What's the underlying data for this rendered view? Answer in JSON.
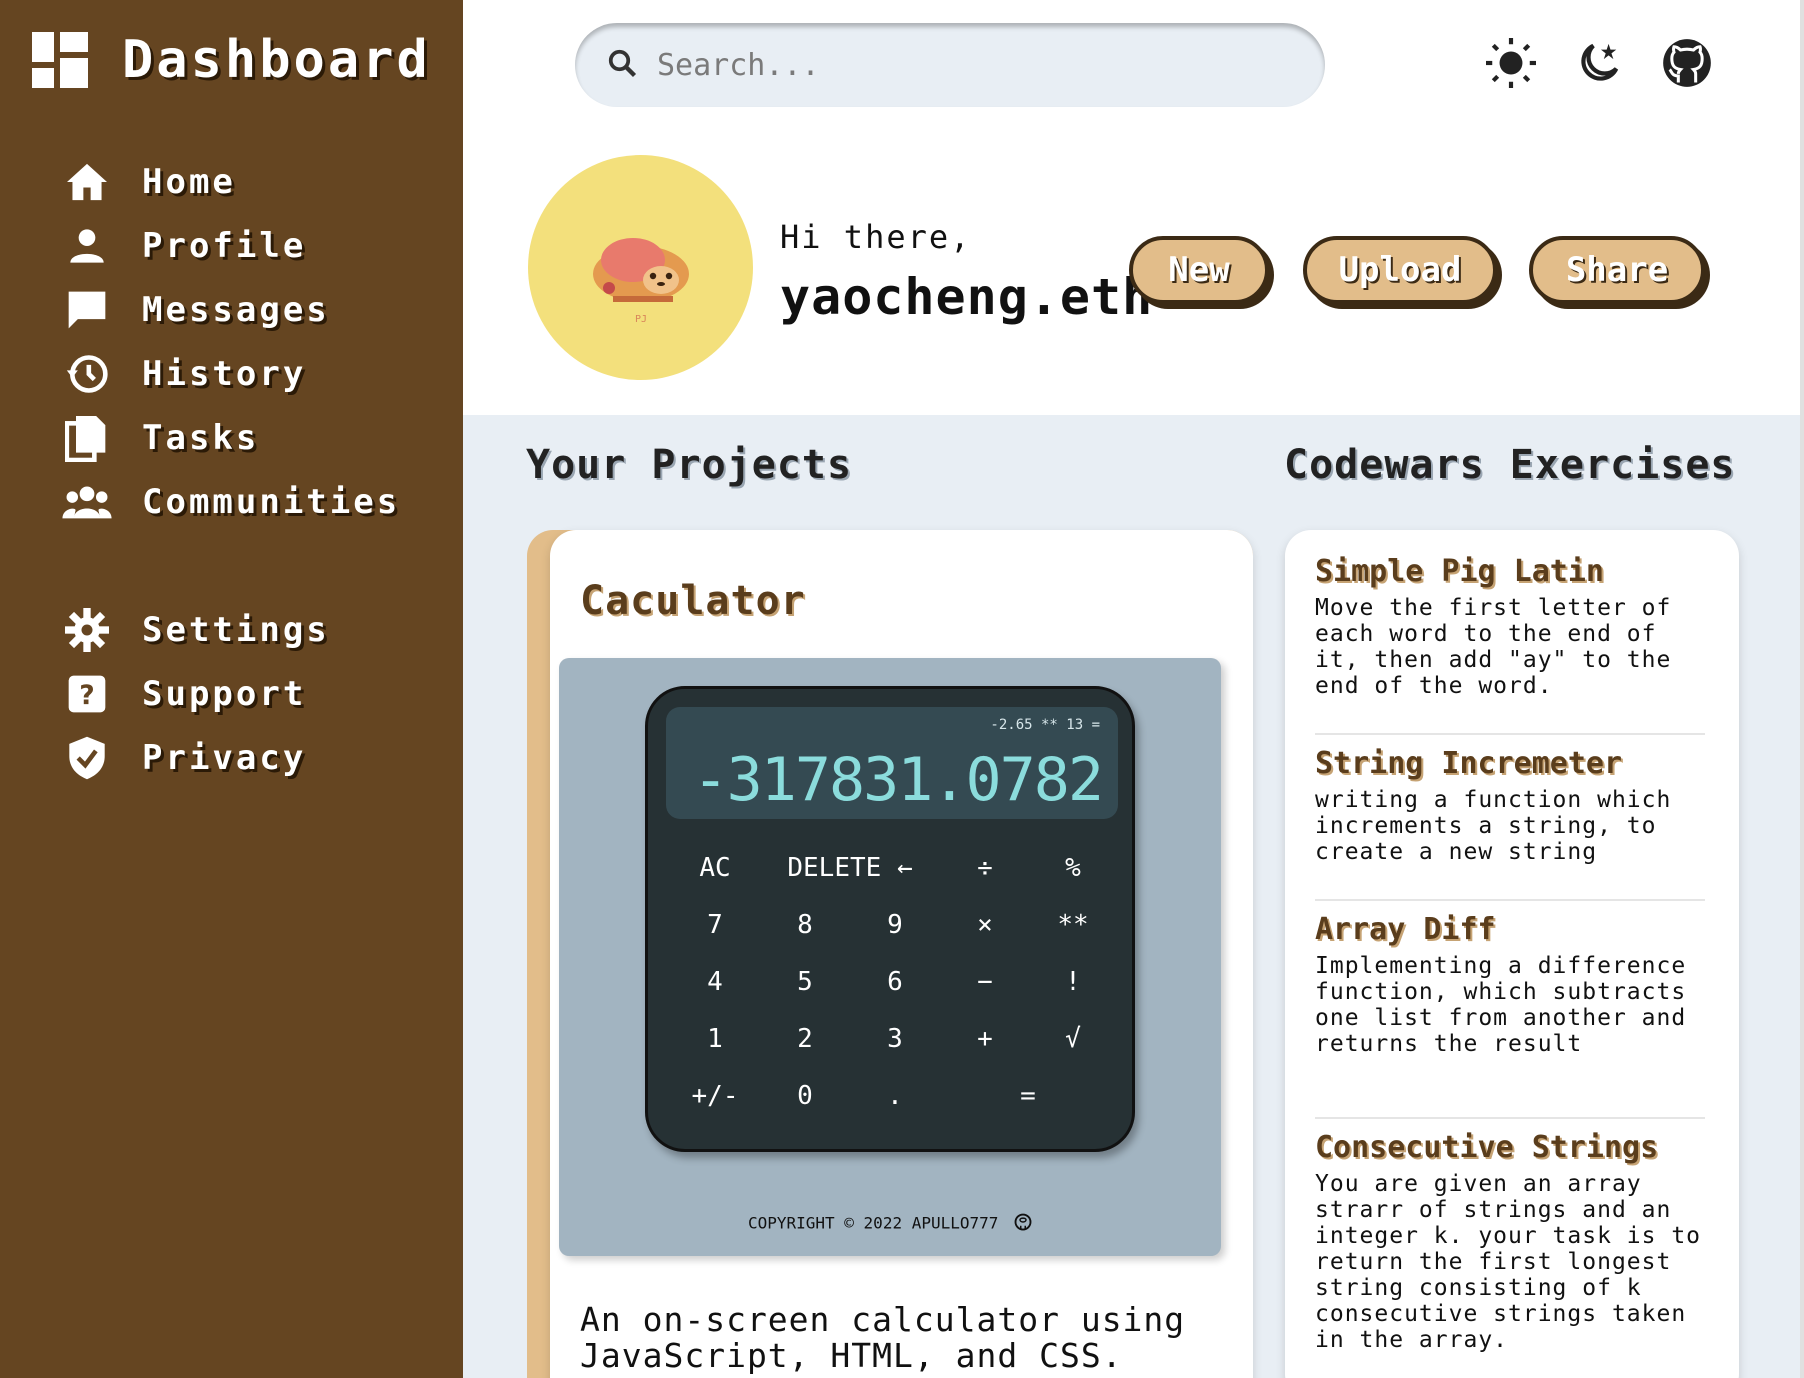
{
  "sidebar": {
    "brand": "Dashboard",
    "items": [
      {
        "label": "Home",
        "icon": "home-icon"
      },
      {
        "label": "Profile",
        "icon": "person-icon"
      },
      {
        "label": "Messages",
        "icon": "chat-icon"
      },
      {
        "label": "History",
        "icon": "history-icon"
      },
      {
        "label": "Tasks",
        "icon": "documents-icon"
      },
      {
        "label": "Communities",
        "icon": "group-icon"
      }
    ],
    "items2": [
      {
        "label": "Settings",
        "icon": "gear-icon"
      },
      {
        "label": "Support",
        "icon": "help-icon"
      },
      {
        "label": "Privacy",
        "icon": "shield-icon"
      }
    ]
  },
  "header": {
    "search_placeholder": "Search...",
    "greeting": "Hi there,",
    "username": "yaocheng.eth",
    "avatar_signature": "PJ",
    "buttons": {
      "new": "New",
      "upload": "Upload",
      "share": "Share"
    }
  },
  "projects": {
    "title": "Your Projects",
    "card": {
      "name": "Caculator",
      "description_line1": "An on-screen calculator using",
      "description_line2": "JavaScript, HTML, and CSS.",
      "calculator": {
        "previous": "-2.65 ** 13 =",
        "current": "-317831.0782",
        "keys": [
          [
            "AC",
            "DELETE ←",
            "÷",
            "%"
          ],
          [
            "7",
            "8",
            "9",
            "×",
            "**"
          ],
          [
            "4",
            "5",
            "6",
            "−",
            "!"
          ],
          [
            "1",
            "2",
            "3",
            "+",
            "√"
          ],
          [
            "+/-",
            "0",
            ".",
            "="
          ]
        ],
        "copyright": "COPYRIGHT © 2022 APULLO777"
      }
    }
  },
  "codewars": {
    "title": "Codewars Exercises",
    "items": [
      {
        "title": "Simple Pig Latin",
        "desc": "Move the first letter of each word to the end of it, then add \"ay\" to the end of the word."
      },
      {
        "title": "String Incremeter",
        "desc": "writing a function which increments a string, to create a new string"
      },
      {
        "title": "Array Diff",
        "desc": "Implementing a difference function, which subtracts one list from another and returns the result"
      },
      {
        "title": "Consecutive Strings",
        "desc": "You are given an array strarr of strings and an integer k. your task is to return the first longest string consisting of k consecutive strings taken in the array."
      }
    ]
  },
  "colors": {
    "sidebar": "#654521",
    "accent": "#e2bd8a",
    "avatar_bg": "#f3e07c",
    "calc_body": "#263134"
  }
}
